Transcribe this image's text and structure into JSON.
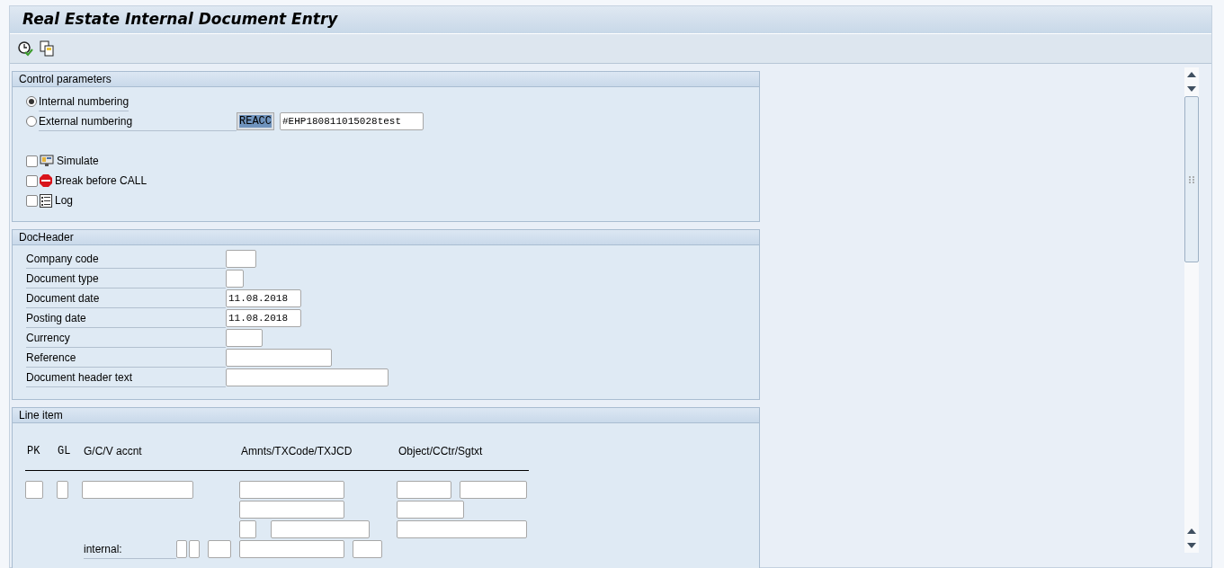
{
  "window": {
    "title": "Real Estate Internal Document Entry"
  },
  "control_parameters": {
    "title": "Control parameters",
    "numbering": [
      {
        "label": "Internal numbering",
        "selected": true
      },
      {
        "label": "External numbering",
        "selected": false
      }
    ],
    "external_code": "REACC",
    "external_number": "#EHP180811015028test",
    "options": [
      {
        "label": "Simulate",
        "checked": false,
        "kind": "simulate"
      },
      {
        "label": "Break before CALL",
        "checked": false,
        "kind": "stop"
      },
      {
        "label": "Log",
        "checked": false,
        "kind": "log"
      }
    ]
  },
  "doc_header": {
    "title": "DocHeader",
    "fields": [
      {
        "label": "Company code",
        "kind": "code"
      },
      {
        "label": "Document type",
        "kind": "type"
      },
      {
        "label": "Document date",
        "value": "11.08.2018",
        "kind": "date"
      },
      {
        "label": "Posting date",
        "value": "11.08.2018",
        "kind": "date"
      },
      {
        "label": "Currency",
        "kind": "currency"
      },
      {
        "label": "Reference",
        "kind": "reference"
      },
      {
        "label": "Document header text",
        "kind": "text"
      }
    ]
  },
  "line_item": {
    "title": "Line item",
    "columns": [
      "PK",
      "GL",
      "G/C/V accnt",
      "Amnts/TXCode/TXJCD",
      "Object/CCtr/Sgtxt"
    ],
    "internal_label": "internal:"
  }
}
